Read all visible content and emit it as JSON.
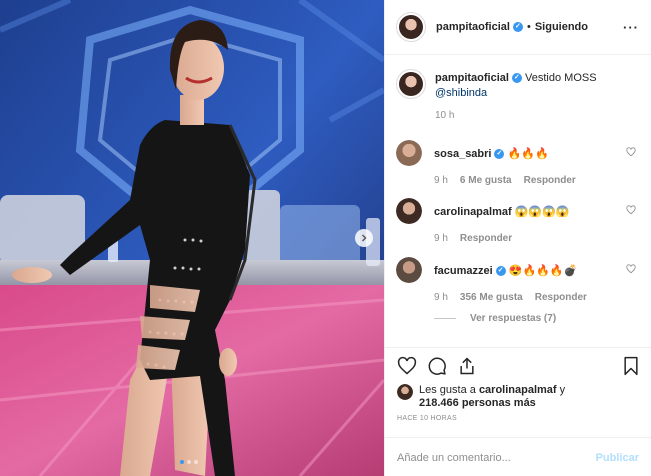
{
  "media": {
    "carousel_dots": [
      true,
      false,
      false
    ]
  },
  "header": {
    "username": "pampitaoficial",
    "separator": "•",
    "follow_status": "Siguiendo",
    "more_icon": "ellipsis-icon"
  },
  "caption": {
    "username": "pampitaoficial",
    "text": "Vestido MOSS",
    "mention": "@shibinda",
    "time": "10 h"
  },
  "comments": [
    {
      "username": "sosa_sabri",
      "verified": true,
      "text": "🔥🔥🔥",
      "time": "9 h",
      "likes": "6 Me gusta",
      "reply": "Responder",
      "avatar_color": "#8a6a55"
    },
    {
      "username": "carolinapalmaf",
      "verified": false,
      "text": "😱😱😱😱",
      "time": "9 h",
      "likes": "",
      "reply": "Responder",
      "avatar_color": "#3d2a22"
    },
    {
      "username": "facumazzei",
      "verified": true,
      "text": "😍🔥🔥🔥💣",
      "time": "9 h",
      "likes": "356 Me gusta",
      "reply": "Responder",
      "avatar_color": "#5b4b41"
    }
  ],
  "view_replies": "Ver respuestas (7)",
  "likes": {
    "prefix": "Les gusta a ",
    "user": "carolinapalmaf",
    "middle": " y",
    "count": "218.466 personas más"
  },
  "timestamp": "HACE 10 HORAS",
  "add_comment": {
    "placeholder": "Añade un comentario...",
    "post_label": "Publicar"
  },
  "colors": {
    "link": "#003569",
    "accent": "#3897f0",
    "muted": "#8e8e8e",
    "post_disabled": "#b2dffc"
  }
}
